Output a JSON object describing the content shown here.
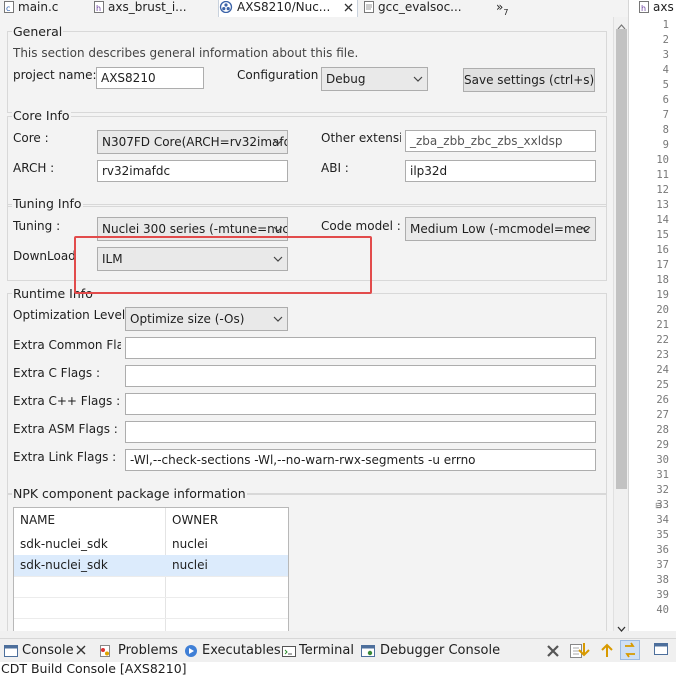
{
  "tabs": [
    {
      "label": "main.c",
      "active": false
    },
    {
      "label": "axs_brust_i...",
      "active": false
    },
    {
      "label": "AXS8210/Nuc...",
      "active": true
    },
    {
      "label": "gcc_evalsoc...",
      "active": false
    }
  ],
  "tab_overflow": "»",
  "tab_overflow_count": "7",
  "right_tab_label": "axs",
  "general": {
    "title": "General",
    "description": "This section describes general information about this file.",
    "project_name_label": "project name:",
    "project_name_value": "AXS8210",
    "configuration_label": "Configuration",
    "configuration_value": "Debug",
    "save_button": "Save settings (ctrl+s)"
  },
  "core_info": {
    "title": "Core Info",
    "core_label": "Core :",
    "core_value": "N307FD Core(ARCH=rv32imafdc",
    "other_ext_label": "Other extensio",
    "other_ext_value": "_zba_zbb_zbc_zbs_xxldsp",
    "arch_label": "ARCH :",
    "arch_value": "rv32imafdc",
    "abi_label": "ABI :",
    "abi_value": "ilp32d"
  },
  "tuning_info": {
    "title": "Tuning Info",
    "tuning_label": "Tuning :",
    "tuning_value": "Nuclei 300 series (-mtune=nuc",
    "code_model_label": "Code model :",
    "code_model_value": "Medium Low (-mcmodel=mec",
    "download_label": "DownLoad",
    "download_value": "ILM"
  },
  "runtime_info": {
    "title": "Runtime Info",
    "optimization_label": "Optimization Level",
    "optimization_value": "Optimize size (-Os)",
    "extra_common_label": "Extra Common Fla",
    "extra_common_value": "",
    "extra_c_label": "Extra C Flags :",
    "extra_c_value": "",
    "extra_cpp_label": "Extra C++ Flags :",
    "extra_cpp_value": "",
    "extra_asm_label": "Extra ASM Flags :",
    "extra_asm_value": "",
    "extra_link_label": "Extra Link Flags :",
    "extra_link_value": "-Wl,--check-sections -Wl,--no-warn-rwx-segments  -u errno"
  },
  "npk": {
    "title": "NPK component package information",
    "columns": [
      "NAME",
      "OWNER"
    ],
    "rows": [
      {
        "name": "sdk-nuclei_sdk",
        "owner": "nuclei"
      },
      {
        "name": "sdk-nuclei_sdk",
        "owner": "nuclei"
      }
    ]
  },
  "line_numbers": [
    "1",
    "2",
    "3",
    "4",
    "5",
    "6",
    "7",
    "8",
    "9",
    "10",
    "11",
    "12",
    "13",
    "14",
    "15",
    "16",
    "17",
    "18",
    "19",
    "20",
    "21",
    "22",
    "23",
    "24",
    "25",
    "26",
    "27",
    "28",
    "29",
    "30",
    "31",
    "32",
    "33",
    "34",
    "35",
    "36",
    "37",
    "38",
    "39",
    "40"
  ],
  "bottom_tabs": {
    "console": "Console",
    "problems": "Problems",
    "executables": "Executables",
    "terminal": "Terminal",
    "debugger_console": "Debugger Console"
  },
  "console_title": "CDT Build Console [AXS8210]",
  "colors": {
    "highlight_box": "#e24b4b",
    "selected_row": "#dcebfc",
    "active_tab_icon": "#3b63a8"
  }
}
